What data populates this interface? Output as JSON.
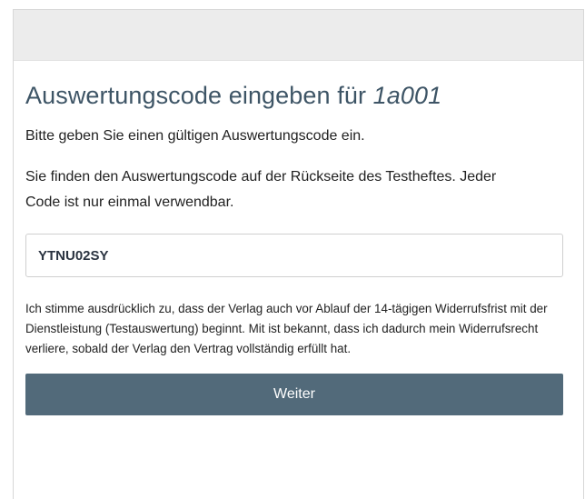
{
  "header": {},
  "form": {
    "title_prefix": "Auswertungscode eingeben für",
    "title_id": "1a001",
    "intro": "Bitte geben Sie einen gültigen Auswertungscode ein.",
    "hint": "Sie finden den Auswertungscode auf der Rückseite des Testheftes. Jeder Code ist nur einmal verwendbar.",
    "code_value": "YTNU02SY",
    "consent": "Ich stimme ausdrücklich zu, dass der Verlag auch vor Ablauf der 14-tägigen Widerrufsfrist mit der Dienstleistung (Testauswertung) beginnt. Mit ist bekannt, dass ich dadurch mein Widerrufsrecht verliere, sobald der Verlag den Vertrag vollständig erfüllt hat.",
    "submit_label": "Weiter"
  },
  "colors": {
    "header_bg": "#ececec",
    "title": "#3e5566",
    "button_bg": "#526a7a",
    "button_text": "#ffffff"
  }
}
